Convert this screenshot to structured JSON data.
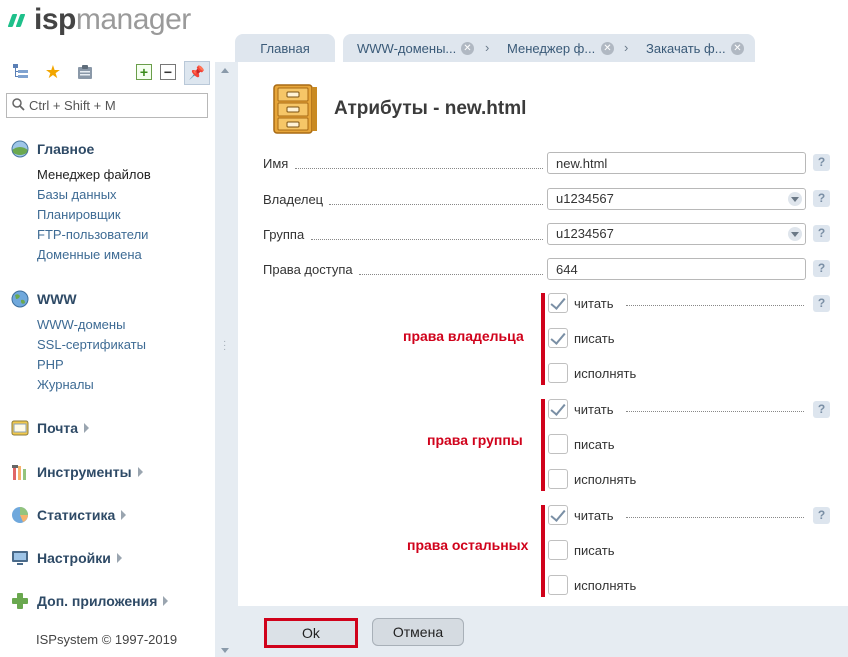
{
  "app": {
    "logo_isp": "isp",
    "logo_manager": "manager",
    "copyright": "ISPsystem © 1997-2019"
  },
  "sidebar": {
    "search_placeholder": "Ctrl + Shift + M",
    "toolbar_icons": [
      "tree-icon",
      "star-icon",
      "clipboard-icon",
      "plus-icon",
      "minus-icon",
      "pin-icon"
    ],
    "groups": [
      {
        "label": "Главное",
        "icon": "home-icon",
        "items": [
          "Менеджер файлов",
          "Базы данных",
          "Планировщик",
          "FTP-пользователи",
          "Доменные имена"
        ],
        "active": "Менеджер файлов"
      },
      {
        "label": "WWW",
        "icon": "globe-icon",
        "items": [
          "WWW-домены",
          "SSL-сертификаты",
          "PHP",
          "Журналы"
        ]
      },
      {
        "label": "Почта",
        "icon": "mail-icon",
        "items": []
      },
      {
        "label": "Инструменты",
        "icon": "tools-icon",
        "items": []
      },
      {
        "label": "Статистика",
        "icon": "pie-chart-icon",
        "items": []
      },
      {
        "label": "Настройки",
        "icon": "monitor-icon",
        "items": []
      },
      {
        "label": "Доп. приложения",
        "icon": "green-plus-icon",
        "items": []
      }
    ]
  },
  "tabs": {
    "home": "Главная",
    "chain": [
      "WWW-домены...",
      "Менеджер ф...",
      "Закачать ф..."
    ]
  },
  "form": {
    "title": "Атрибуты - new.html",
    "fields": {
      "name_label": "Имя",
      "name_value": "new.html",
      "owner_label": "Владелец",
      "owner_value": "u1234567",
      "group_label": "Группа",
      "group_value": "u1234567",
      "perms_label": "Права доступа",
      "perms_value": "644"
    },
    "permissions": [
      {
        "title": "права владельца",
        "read": true,
        "write": true,
        "exec": false
      },
      {
        "title": "права группы",
        "read": true,
        "write": false,
        "exec": false
      },
      {
        "title": "права остальных",
        "read": true,
        "write": false,
        "exec": false
      }
    ],
    "perm_labels": {
      "read": "читать",
      "write": "писать",
      "exec": "исполнять"
    },
    "help": "?",
    "ok": "Ok",
    "cancel": "Отмена"
  },
  "colors": {
    "accent_red": "#d0021b",
    "link_blue": "#3e6b94",
    "panel_bg": "#e6ecf2",
    "logo_green": "#1ec08a"
  }
}
